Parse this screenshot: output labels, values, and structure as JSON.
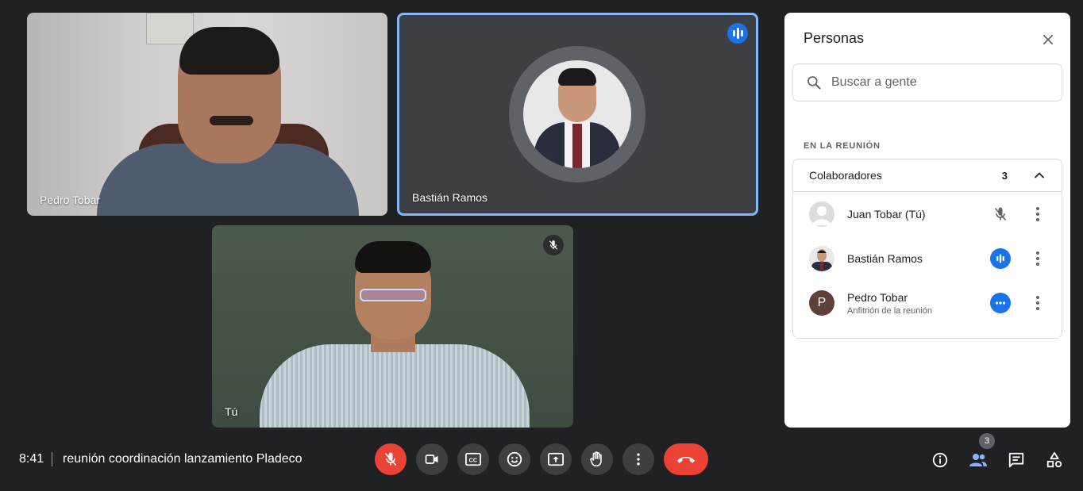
{
  "tiles": {
    "pedro": {
      "name": "Pedro Tobar"
    },
    "bastian": {
      "name": "Bastián Ramos",
      "speaking": true
    },
    "self": {
      "name": "Tú",
      "muted": true
    }
  },
  "panel": {
    "title": "Personas",
    "search_placeholder": "Buscar a gente",
    "section_label": "EN LA REUNIÓN",
    "group": {
      "name": "Colaboradores",
      "count": "3"
    },
    "people": [
      {
        "name": "Juan Tobar (Tú)",
        "subtitle": "",
        "status": "muted"
      },
      {
        "name": "Bastián Ramos",
        "subtitle": "",
        "status": "speaking"
      },
      {
        "name": "Pedro Tobar",
        "subtitle": "Anfitrión de la reunión",
        "status": "more",
        "initial": "P"
      }
    ]
  },
  "bottom_bar": {
    "time": "8:41",
    "meeting_title": "reunión coordinación lanzamiento Pladeco",
    "people_count": "3"
  },
  "colors": {
    "accent": "#1a73e8",
    "end_call": "#ea4335",
    "background": "#202124",
    "speaking_border": "#8ab4f8"
  }
}
